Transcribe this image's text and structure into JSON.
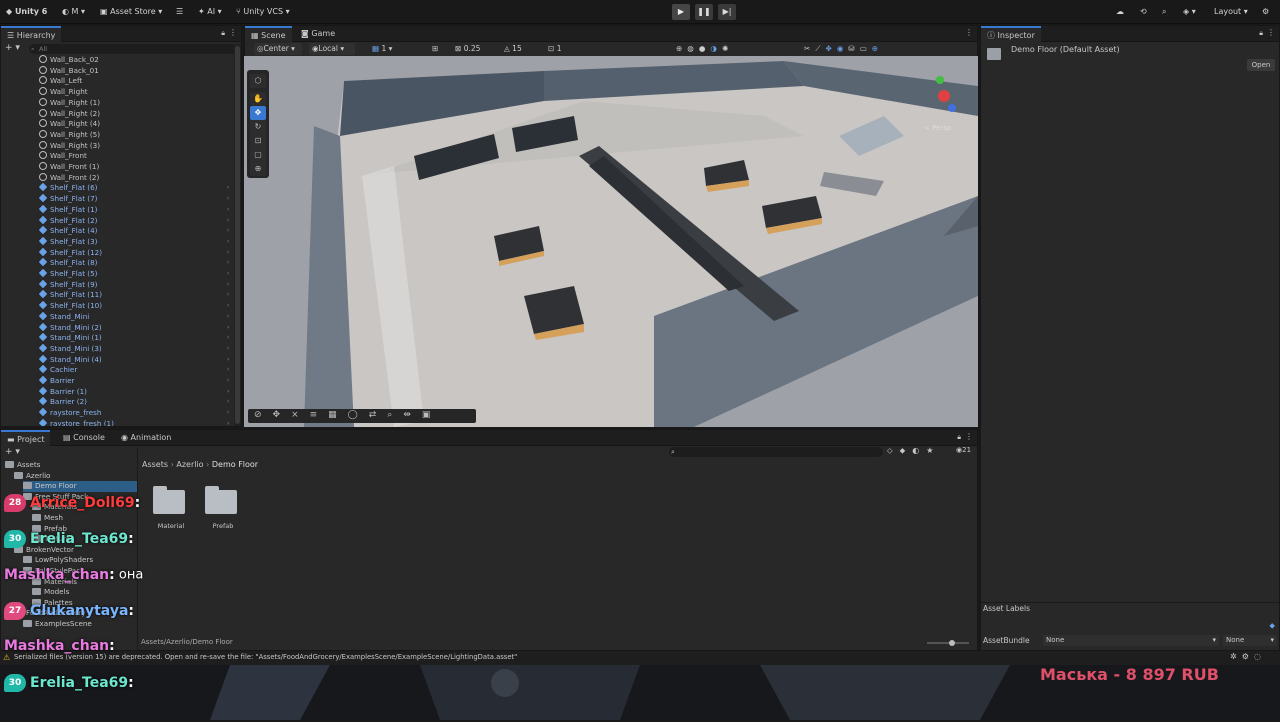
{
  "topbar": {
    "app": "Unity 6",
    "account": "M",
    "asset_store": "Asset Store",
    "ai": "AI",
    "vcs": "Unity VCS",
    "layout": "Layout"
  },
  "hierarchy": {
    "tab": "Hierarchy",
    "search_placeholder": "All",
    "items": [
      {
        "label": "Wall_Back_02",
        "prefab": false
      },
      {
        "label": "Wall_Back_01",
        "prefab": false
      },
      {
        "label": "Wall_Left",
        "prefab": false
      },
      {
        "label": "Wall_Right",
        "prefab": false
      },
      {
        "label": "Wall_Right (1)",
        "prefab": false
      },
      {
        "label": "Wall_Right (2)",
        "prefab": false
      },
      {
        "label": "Wall_Right (4)",
        "prefab": false
      },
      {
        "label": "Wall_Right (5)",
        "prefab": false
      },
      {
        "label": "Wall_Right (3)",
        "prefab": false
      },
      {
        "label": "Wall_Front",
        "prefab": false
      },
      {
        "label": "Wall_Front (1)",
        "prefab": false
      },
      {
        "label": "Wall_Front (2)",
        "prefab": false
      },
      {
        "label": "Shelf_Flat (6)",
        "prefab": true
      },
      {
        "label": "Shelf_Flat (7)",
        "prefab": true
      },
      {
        "label": "Shelf_Flat (1)",
        "prefab": true
      },
      {
        "label": "Shelf_Flat (2)",
        "prefab": true
      },
      {
        "label": "Shelf_Flat (4)",
        "prefab": true
      },
      {
        "label": "Shelf_Flat (3)",
        "prefab": true
      },
      {
        "label": "Shelf_Flat (12)",
        "prefab": true
      },
      {
        "label": "Shelf_Flat (8)",
        "prefab": true
      },
      {
        "label": "Shelf_Flat (5)",
        "prefab": true
      },
      {
        "label": "Shelf_Flat (9)",
        "prefab": true
      },
      {
        "label": "Shelf_Flat (11)",
        "prefab": true
      },
      {
        "label": "Shelf_Flat (10)",
        "prefab": true
      },
      {
        "label": "Stand_Mini",
        "prefab": true
      },
      {
        "label": "Stand_Mini (2)",
        "prefab": true
      },
      {
        "label": "Stand_Mini (1)",
        "prefab": true
      },
      {
        "label": "Stand_Mini (3)",
        "prefab": true
      },
      {
        "label": "Stand_Mini (4)",
        "prefab": true
      },
      {
        "label": "Cachier",
        "prefab": true
      },
      {
        "label": "Barrier",
        "prefab": true
      },
      {
        "label": "Barrier (1)",
        "prefab": true
      },
      {
        "label": "Barrier (2)",
        "prefab": true
      },
      {
        "label": "raystore_fresh",
        "prefab": true
      },
      {
        "label": "raystore_fresh (1)",
        "prefab": true
      }
    ]
  },
  "scene": {
    "tab_scene": "Scene",
    "tab_game": "Game",
    "pivot": "Center",
    "space": "Local",
    "grid_value": "1",
    "snap_value": "0.25",
    "rotate_snap": "15",
    "scale_snap": "1",
    "projection": "< Persp"
  },
  "project": {
    "tab_project": "Project",
    "tab_console": "Console",
    "tab_animation": "Animation",
    "breadcrumb": [
      "Assets",
      "Azerlio",
      "Demo Floor"
    ],
    "tree": [
      {
        "label": "Assets",
        "indent": 0
      },
      {
        "label": "Azerlio",
        "indent": 1
      },
      {
        "label": "Demo Floor",
        "indent": 2
      },
      {
        "label": "Free Stuff Pack",
        "indent": 2
      },
      {
        "label": "Materials",
        "indent": 3
      },
      {
        "label": "Mesh",
        "indent": 3
      },
      {
        "label": "Prefab",
        "indent": 3
      },
      {
        "label": "Textures",
        "indent": 3
      },
      {
        "label": "BrokenVector",
        "indent": 1
      },
      {
        "label": "LowPolyShaders",
        "indent": 2
      },
      {
        "label": "PolyStylePack",
        "indent": 2
      },
      {
        "label": "Materials",
        "indent": 3
      },
      {
        "label": "Models",
        "indent": 3
      },
      {
        "label": "Palettes",
        "indent": 3
      },
      {
        "label": "FoodAndGrocery",
        "indent": 1
      },
      {
        "label": "ExamplesScene",
        "indent": 2
      }
    ],
    "assets": [
      {
        "label": "Material"
      },
      {
        "label": "Prefab"
      }
    ],
    "path_footer": "Assets/Azerlio/Demo Floor",
    "item_count": "21"
  },
  "inspector": {
    "tab": "Inspector",
    "title": "Demo Floor (Default Asset)",
    "open_button": "Open",
    "asset_labels": "Asset Labels",
    "asset_bundle_label": "AssetBundle",
    "asset_bundle_value": "None",
    "asset_variant_value": "None"
  },
  "status": {
    "warning": "Serialized files (version 15) are deprecated. Open and re-save the file: \"Assets/FoodAndGrocery/ExamplesScene/ExampleScene/LightingData.asset\""
  },
  "overlay": {
    "donation": "Маська - 8 897 RUB",
    "chat": [
      {
        "badge": "28",
        "badge_color": "#d93b6a",
        "name": "Arrice_Doll69",
        "name_color": "#ff3b3b",
        "msg": ""
      },
      {
        "badge": "30",
        "badge_color": "#21b8a8",
        "name": "Erelia_Tea69",
        "name_color": "#6de8d0",
        "msg": ""
      },
      {
        "badge": "",
        "badge_color": "",
        "name": "Mashka_chan",
        "name_color": "#e87ae0",
        "msg": "она"
      },
      {
        "badge": "27",
        "badge_color": "#e04a7e",
        "name": "Glukanytaya",
        "name_color": "#7ab6ff",
        "msg": ""
      },
      {
        "badge": "",
        "badge_color": "",
        "name": "Mashka_chan",
        "name_color": "#e87ae0",
        "msg": ""
      },
      {
        "badge": "30",
        "badge_color": "#21b8a8",
        "name": "Erelia_Tea69",
        "name_color": "#6de8d0",
        "msg": ""
      }
    ]
  }
}
